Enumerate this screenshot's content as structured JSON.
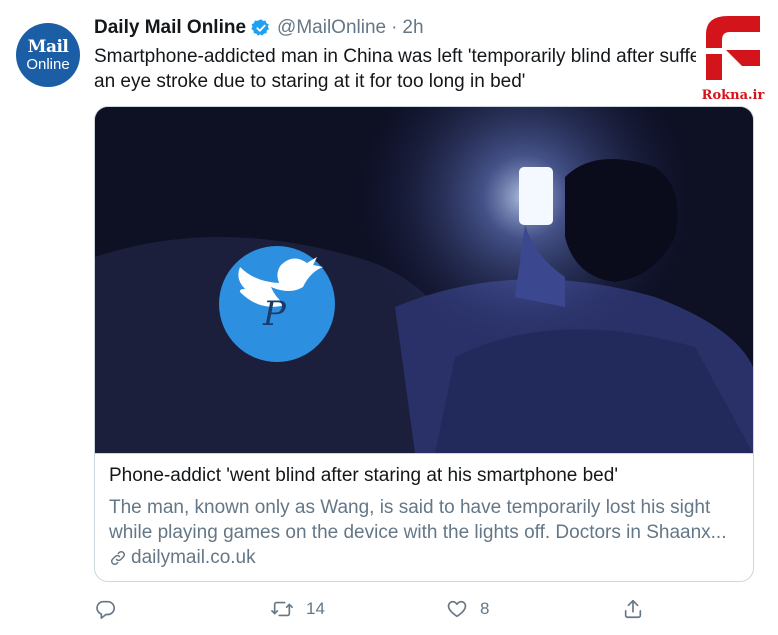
{
  "tweet": {
    "avatar": {
      "line1": "Mail",
      "line2": "Online"
    },
    "display_name": "Daily Mail Online",
    "handle": "@MailOnline",
    "separator": "·",
    "time": "2h",
    "text_lines": [
      "Smartphone-addicted man in China was left 'temporarily blind after suffer",
      "an eye stroke due to staring at it for too long in bed'"
    ]
  },
  "watermark": {
    "text": "Rokna.ir",
    "color": "#d3151b"
  },
  "card": {
    "title": "Phone-addict 'went blind after staring at his smartphone bed'",
    "description_lines": [
      "The man, known only as Wang, is said to have temporarily lost his sight",
      "while playing games on the device with the lights off. Doctors in Shaanx..."
    ],
    "domain": "dailymail.co.uk"
  },
  "actions": {
    "reply_count": "",
    "retweet_count": "14",
    "like_count": "8"
  },
  "colors": {
    "brand_blue": "#1da1f2",
    "text": "#14171a",
    "secondary_text": "#657786",
    "border": "#ccd6dd",
    "avatar_bg": "#1b5ea6"
  },
  "icons": [
    "verified-badge-icon",
    "chevron-down-icon",
    "link-icon",
    "reply-icon",
    "retweet-icon",
    "like-icon",
    "share-icon",
    "twitter-bird-logo-icon"
  ]
}
